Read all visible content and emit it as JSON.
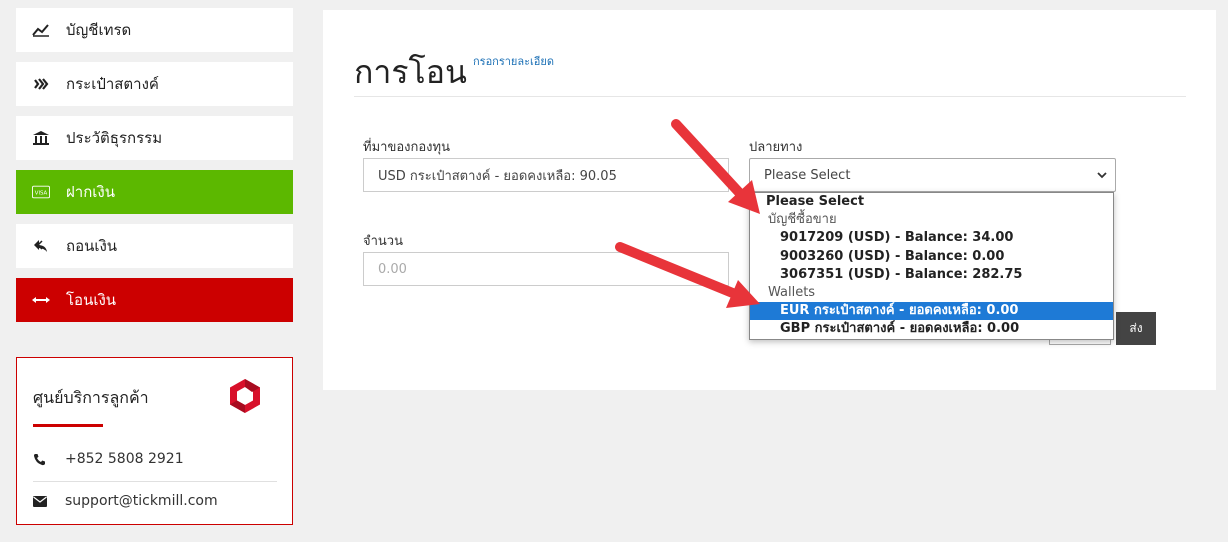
{
  "sidebar": {
    "items": [
      {
        "label": "บัญชีเทรด",
        "icon": "chart-line-icon"
      },
      {
        "label": "กระเป๋าสตางค์",
        "icon": "wallet-icon"
      },
      {
        "label": "ประวัติธุรกรรม",
        "icon": "bank-icon"
      },
      {
        "label": "ฝากเงิน",
        "icon": "visa-card-icon"
      },
      {
        "label": "ถอนเงิน",
        "icon": "reply-icon"
      },
      {
        "label": "โอนเงิน",
        "icon": "transfer-arrows-icon"
      }
    ]
  },
  "support": {
    "title": "ศูนย์บริการลูกค้า",
    "phone": "+852 5808 2921",
    "email": "support@tickmill.com"
  },
  "transfer": {
    "title": "การโอน",
    "fill_link": "กรอกรายละเอียด",
    "source_label": "ที่มาของกองทุน",
    "source_value": "USD กระเป๋าสตางค์ - ยอดคงเหลือ: 90.05",
    "dest_label": "ปลายทาง",
    "dest_value": "Please Select",
    "amount_label": "จำนวน",
    "amount_placeholder": "0.00",
    "submit_label": "ส่ง"
  },
  "dropdown": {
    "placeholder": "Please Select",
    "group_accounts": "บัญชีซื้อขาย",
    "accounts": [
      "9017209 (USD) - Balance: 34.00",
      "9003260 (USD) - Balance: 0.00",
      "3067351 (USD) - Balance: 282.75"
    ],
    "group_wallets": "Wallets",
    "wallets": [
      "EUR กระเป๋าสตางค์ - ยอดคงเหลือ: 0.00",
      "GBP กระเป๋าสตางค์ - ยอดคงเหลือ: 0.00"
    ]
  },
  "colors": {
    "accent_red": "#cc0000",
    "accent_green": "#5cb800",
    "selected_blue": "#1e7ad6",
    "arrow_red": "#e8343a"
  }
}
